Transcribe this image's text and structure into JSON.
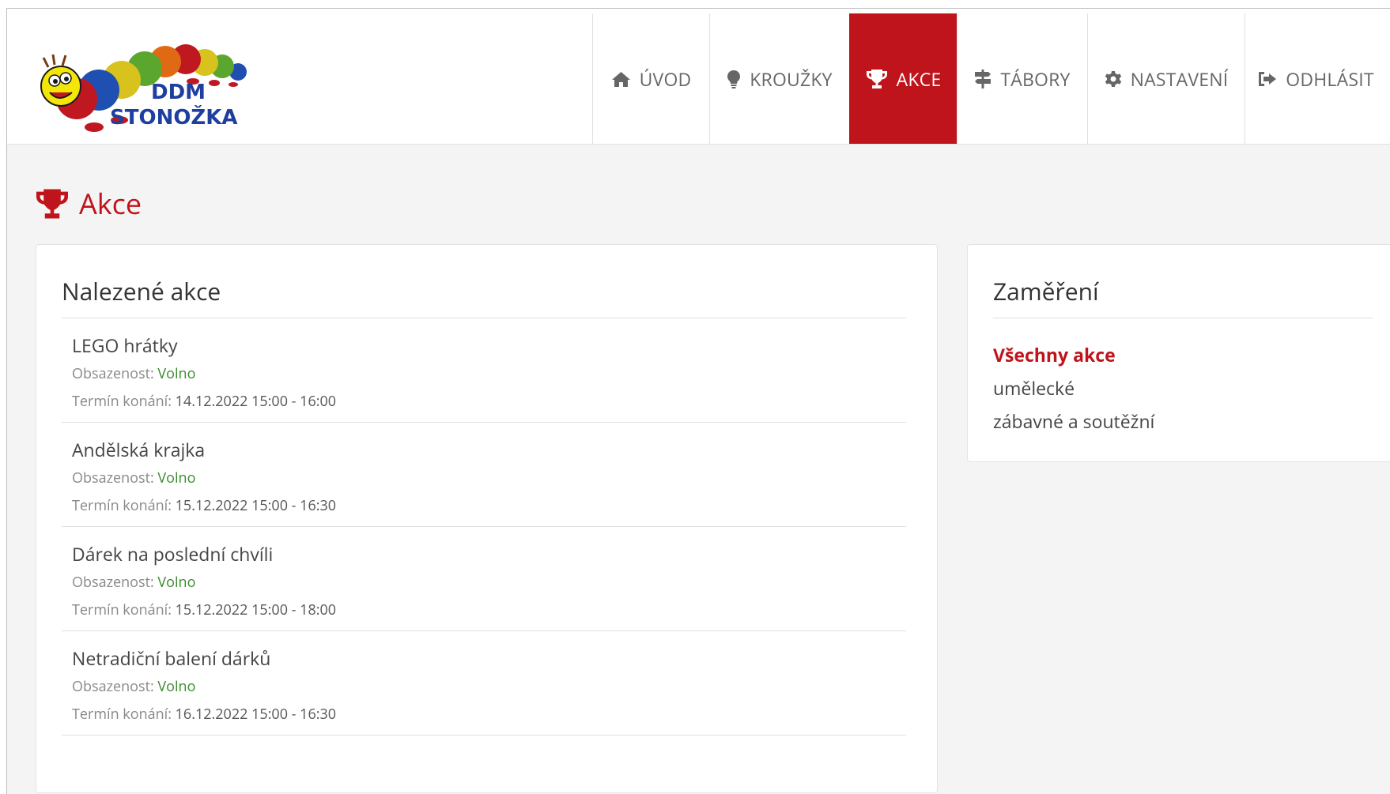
{
  "logo": {
    "line1": "DDM",
    "line2": "STONOŽKA"
  },
  "nav": {
    "items": [
      {
        "label": "ÚVOD",
        "icon": "home-icon"
      },
      {
        "label": "KROUŽKY",
        "icon": "lightbulb-icon"
      },
      {
        "label": "AKCE",
        "icon": "trophy-icon",
        "active": true
      },
      {
        "label": "TÁBORY",
        "icon": "signpost-icon"
      },
      {
        "label": "NASTAVENÍ",
        "icon": "gear-icon"
      },
      {
        "label": "ODHLÁSIT",
        "icon": "sign-out-icon"
      }
    ]
  },
  "page": {
    "title": "Akce",
    "title_icon": "trophy-icon"
  },
  "events_panel": {
    "heading": "Nalezené akce",
    "occupancy_label": "Obsazenost:",
    "date_label": "Termín konání:",
    "events": [
      {
        "title": "LEGO hrátky",
        "occupancy": "Volno",
        "date": "14.12.2022 15:00 - 16:00"
      },
      {
        "title": "Andělská krajka",
        "occupancy": "Volno",
        "date": "15.12.2022 15:00 - 16:30"
      },
      {
        "title": "Dárek na poslední chvíli",
        "occupancy": "Volno",
        "date": "15.12.2022 15:00 - 18:00"
      },
      {
        "title": "Netradiční balení dárků",
        "occupancy": "Volno",
        "date": "16.12.2022 15:00 - 16:30"
      }
    ]
  },
  "focus_panel": {
    "heading": "Zaměření",
    "categories": [
      {
        "label": "Všechny akce",
        "active": true
      },
      {
        "label": "umělecké"
      },
      {
        "label": "zábavné a soutěžní"
      }
    ]
  },
  "colors": {
    "accent": "#c0141c",
    "available": "#3a8b2e",
    "page_bg": "#f4f4f4"
  }
}
